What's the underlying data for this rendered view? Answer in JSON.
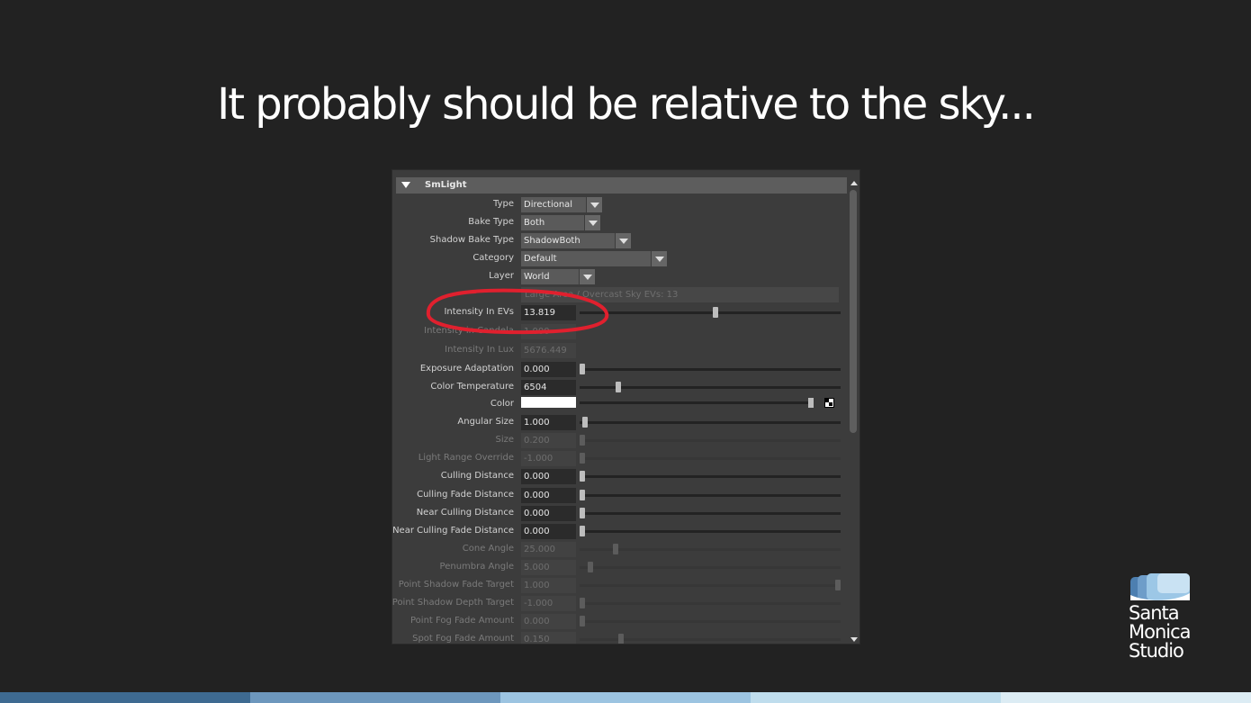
{
  "slide": {
    "title": "It probably should be relative to the sky..."
  },
  "panel": {
    "header": "SmLight",
    "info_text": "Large Area / Overcast Sky EVs: 13",
    "dropdowns": [
      {
        "label": "Type",
        "value": "Directional"
      },
      {
        "label": "Bake Type",
        "value": "Both"
      },
      {
        "label": "Shadow Bake Type",
        "value": "ShadowBoth"
      },
      {
        "label": "Category",
        "value": "Default"
      },
      {
        "label": "Layer",
        "value": "World"
      }
    ],
    "fields": [
      {
        "label": "Intensity In EVs",
        "value": "13.819",
        "enabled": true,
        "slider": 0.52
      },
      {
        "label": "Intensity in Candela",
        "value": "1.000",
        "enabled": false
      },
      {
        "label": "Intensity In Lux",
        "value": "5676.449",
        "enabled": false
      },
      {
        "label": "Exposure Adaptation",
        "value": "0.000",
        "enabled": true,
        "slider": 0.0
      },
      {
        "label": "Color Temperature",
        "value": "6504",
        "enabled": true,
        "slider": 0.14
      },
      {
        "label": "Color",
        "value": "",
        "enabled": true
      },
      {
        "label": "Angular Size",
        "value": "1.000",
        "enabled": true,
        "slider": 0.01
      },
      {
        "label": "Size",
        "value": "0.200",
        "enabled": false,
        "slider": 0.0
      },
      {
        "label": "Light Range Override",
        "value": "-1.000",
        "enabled": false,
        "slider": 0.0
      },
      {
        "label": "Culling Distance",
        "value": "0.000",
        "enabled": true,
        "slider": 0.0
      },
      {
        "label": "Culling Fade Distance",
        "value": "0.000",
        "enabled": true,
        "slider": 0.0
      },
      {
        "label": "Near Culling Distance",
        "value": "0.000",
        "enabled": true,
        "slider": 0.0
      },
      {
        "label": "Near Culling Fade Distance",
        "value": "0.000",
        "enabled": true,
        "slider": 0.0
      },
      {
        "label": "Cone Angle",
        "value": "25.000",
        "enabled": false,
        "slider": 0.13
      },
      {
        "label": "Penumbra Angle",
        "value": "5.000",
        "enabled": false,
        "slider": 0.03
      },
      {
        "label": "Point Shadow Fade Target",
        "value": "1.000",
        "enabled": false,
        "slider": 1.0
      },
      {
        "label": "Point Shadow Depth Target",
        "value": "-1.000",
        "enabled": false,
        "slider": 0.0
      },
      {
        "label": "Point Fog Fade Amount",
        "value": "0.000",
        "enabled": false,
        "slider": 0.0
      },
      {
        "label": "Spot Fog Fade Amount",
        "value": "0.150",
        "enabled": false,
        "slider": 0.15
      }
    ]
  },
  "logo": {
    "line1": "Santa",
    "line2": "Monica",
    "line3": "Studio"
  },
  "colors": {
    "background": "#222222",
    "panel": "#3c3c3c",
    "annotation": "#e0202e",
    "stripe": [
      "#3e6a91",
      "#6d97bd",
      "#9cc4e1",
      "#bfdded",
      "#dcecf4"
    ]
  }
}
